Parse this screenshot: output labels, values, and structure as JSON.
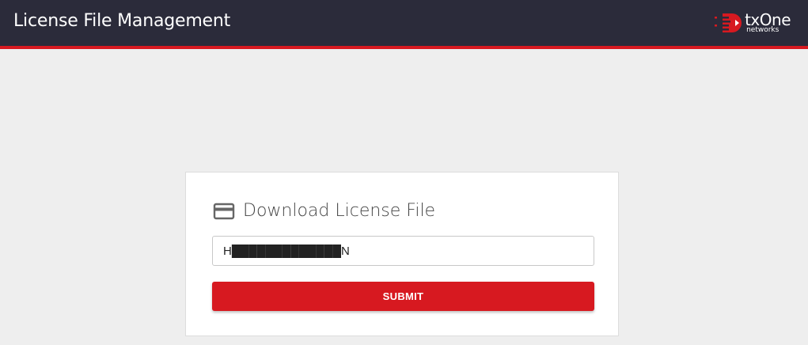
{
  "header": {
    "title": "License File Management",
    "brand": {
      "name": "txOne",
      "tagline": "networks",
      "icon": "txone-logo-icon",
      "color": "#d71920"
    },
    "background": "#2b2b3a",
    "accent": "#d71920"
  },
  "card": {
    "icon": "credit-card-icon",
    "title": "Download License File",
    "license_input": {
      "value": "H█████████████N",
      "placeholder": ""
    },
    "submit_label": "SUBMIT"
  }
}
